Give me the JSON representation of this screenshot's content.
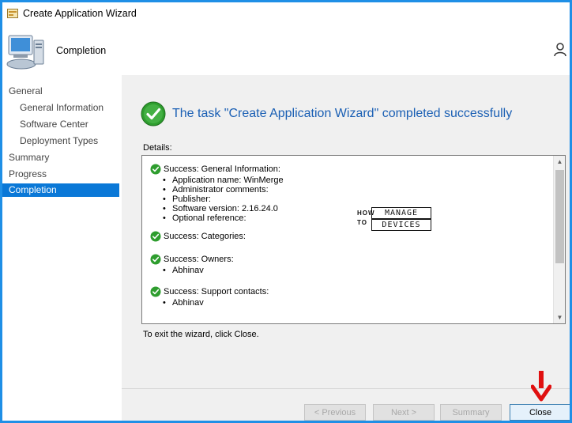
{
  "window": {
    "title": "Create Application Wizard"
  },
  "header": {
    "title": "Completion"
  },
  "sidebar": {
    "items": [
      {
        "label": "General",
        "level": 1,
        "active": false
      },
      {
        "label": "General Information",
        "level": 2,
        "active": false
      },
      {
        "label": "Software Center",
        "level": 2,
        "active": false
      },
      {
        "label": "Deployment Types",
        "level": 2,
        "active": false
      },
      {
        "label": "Summary",
        "level": 1,
        "active": false
      },
      {
        "label": "Progress",
        "level": 1,
        "active": false
      },
      {
        "label": "Completion",
        "level": 1,
        "active": true
      }
    ]
  },
  "main": {
    "headline": "The task \"Create Application Wizard\" completed successfully",
    "details_label": "Details:",
    "exit_text": "To exit the wizard, click Close.",
    "details": [
      {
        "title": "Success: General Information:",
        "bullets": [
          "Application name: WinMerge",
          "Administrator comments:",
          "Publisher:",
          "Software version: 2.16.24.0",
          "Optional reference:"
        ]
      },
      {
        "title": "Success: Categories:",
        "bullets": []
      },
      {
        "title": "Success: Owners:",
        "bullets": [
          "Abhinav"
        ]
      },
      {
        "title": "Success: Support contacts:",
        "bullets": [
          "Abhinav"
        ]
      }
    ]
  },
  "watermark": {
    "line1": "HOW",
    "line2": "TO",
    "line3": "MANAGE",
    "line4": "DEVICES"
  },
  "buttons": {
    "previous": "< Previous",
    "next": "Next >",
    "summary": "Summary",
    "close": "Close"
  },
  "colors": {
    "accent": "#0a78d7",
    "border": "#1f8fe6",
    "headline": "#1a5fb4",
    "success": "#2e9d2e",
    "arrow": "#e01010"
  },
  "icons": {
    "app": "wizard-app-icon",
    "header": "computer-icon",
    "user": "user-icon",
    "success": "checkmark-circle-icon"
  }
}
